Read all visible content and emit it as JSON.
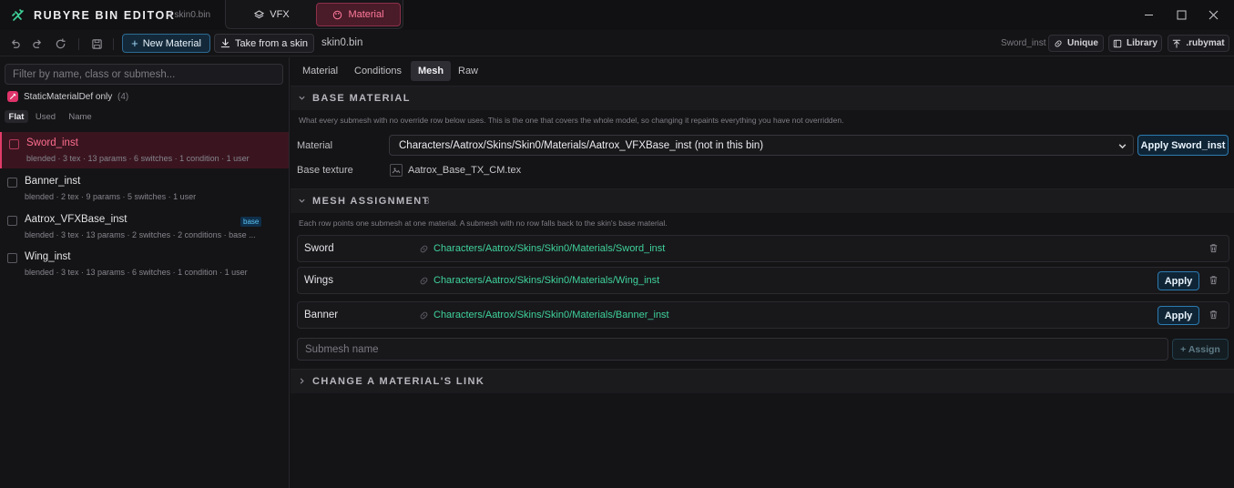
{
  "app": {
    "title": "RUBYRE BIN EDITOR",
    "file_crumb": "/ skin0.bin"
  },
  "mode_tabs": [
    {
      "label": "VFX"
    },
    {
      "label": "Material",
      "active": true
    }
  ],
  "toolbar": {
    "new_material": "New Material",
    "take_from_skin": "Take from a skin",
    "file": "skin0.bin",
    "current": "Sword_inst",
    "unique": "Unique",
    "library": "Library",
    "rubymat": ".rubymat"
  },
  "sidebar": {
    "filter_placeholder": "Filter by name, class or submesh...",
    "toggle_label": "StaticMaterialDef only",
    "toggle_count": "(4)",
    "views": [
      "Flat",
      "Used",
      "Name"
    ],
    "items": [
      {
        "name": "Sword_inst",
        "meta": "blended · 3 tex · 13 params · 6 switches · 1 condition · 1 user",
        "selected": true
      },
      {
        "name": "Banner_inst",
        "meta": "blended · 2 tex · 9 params · 5 switches · 1 user"
      },
      {
        "name": "Aatrox_VFXBase_inst",
        "badge": "base",
        "meta": "blended · 3 tex · 13 params · 2 switches · 2 conditions · base ..."
      },
      {
        "name": "Wing_inst",
        "meta": "blended · 3 tex · 13 params · 6 switches · 1 condition · 1 user"
      }
    ]
  },
  "main": {
    "tabs": [
      "Material",
      "Conditions",
      "Mesh",
      "Raw"
    ],
    "active_tab": "Mesh",
    "base_material": {
      "title": "BASE MATERIAL",
      "desc": "What every submesh with no override row below uses. This is the one that covers the whole model, so changing it repaints everything you have not overridden.",
      "material_label": "Material",
      "material_value": "Characters/Aatrox/Skins/Skin0/Materials/Aatrox_VFXBase_inst (not in this bin)",
      "apply_label": "Apply Sword_inst",
      "texture_label": "Base texture",
      "texture_value": "Aatrox_Base_TX_CM.tex"
    },
    "mesh_assignment": {
      "title": "MESH ASSIGNMENT",
      "count": "3",
      "desc": "Each row points one submesh at one material. A submesh with no row falls back to the skin's base material.",
      "rows": [
        {
          "submesh": "Sword",
          "path": "Characters/Aatrox/Skins/Skin0/Materials/Sword_inst"
        },
        {
          "submesh": "Wings",
          "path": "Characters/Aatrox/Skins/Skin0/Materials/Wing_inst",
          "apply": "Apply"
        },
        {
          "submesh": "Banner",
          "path": "Characters/Aatrox/Skins/Skin0/Materials/Banner_inst",
          "apply": "Apply"
        }
      ],
      "submesh_placeholder": "Submesh name",
      "assign_label": "+ Assign"
    },
    "change_link": {
      "title": "CHANGE A MATERIAL'S LINK"
    }
  },
  "colors": {
    "accent_pink": "#e23c69",
    "accent_blue": "#2c7bb0",
    "path_green": "#3fd39b"
  }
}
